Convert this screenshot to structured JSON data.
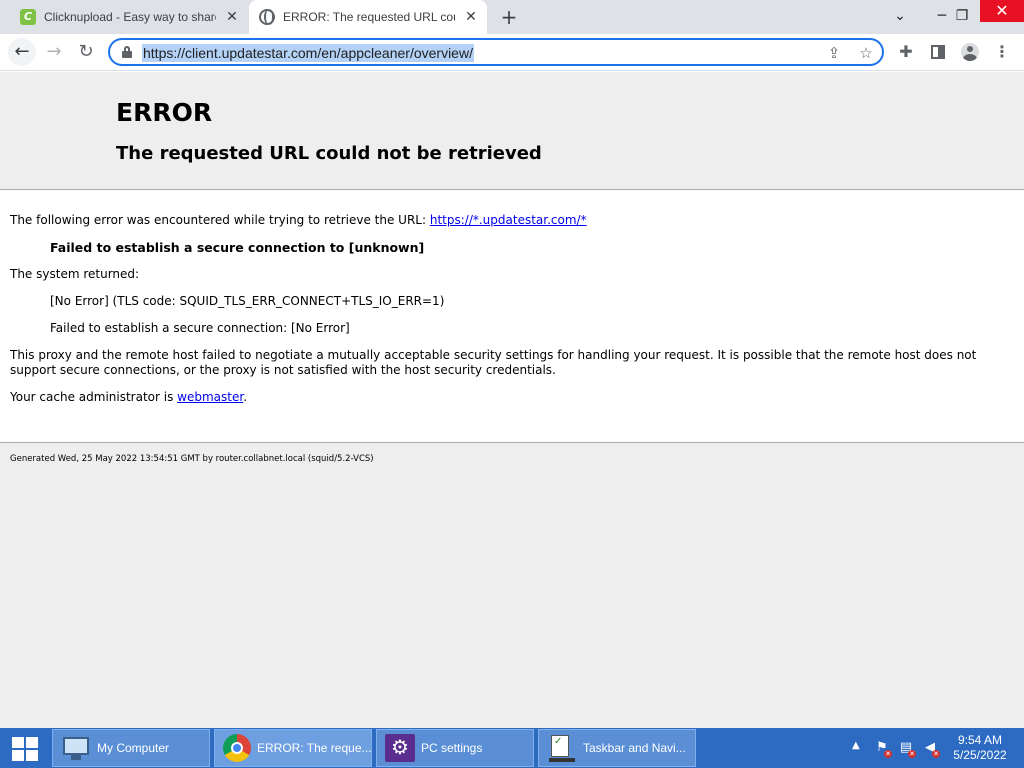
{
  "browser": {
    "tabs": [
      {
        "title": "Clicknupload - Easy way to share",
        "favicon": "clicknupload-icon",
        "active": false
      },
      {
        "title": "ERROR: The requested URL could not be retrieved",
        "favicon": "globe-icon",
        "active": true
      }
    ],
    "new_tab_label": "+",
    "address_bar": {
      "url": "https://client.updatestar.com/en/appcleaner/overview/"
    }
  },
  "page": {
    "heading": "ERROR",
    "subheading": "The requested URL could not be retrieved",
    "intro_text": "The following error was encountered while trying to retrieve the URL: ",
    "intro_link": "https://*.updatestar.com/*",
    "error_message": "Failed to establish a secure connection to [unknown]",
    "system_returned_label": "The system returned:",
    "tls_code": "[No Error] (TLS code: SQUID_TLS_ERR_CONNECT+TLS_IO_ERR=1)",
    "secure_fail": "Failed to establish a secure connection: [No Error]",
    "explanation": "This proxy and the remote host failed to negotiate a mutually acceptable security settings for handling your request. It is possible that the remote host does not support secure connections, or the proxy is not satisfied with the host security credentials.",
    "cache_admin_text": "Your cache administrator is ",
    "cache_admin_link": "webmaster",
    "cache_admin_suffix": ".",
    "footer": "Generated Wed, 25 May 2022 13:54:51 GMT by router.collabnet.local (squid/5.2-VCS)"
  },
  "taskbar": {
    "buttons": [
      {
        "label": "My Computer",
        "icon": "computer-icon"
      },
      {
        "label": "ERROR: The reque...",
        "icon": "chrome-icon"
      },
      {
        "label": "PC settings",
        "icon": "gear-icon"
      },
      {
        "label": "Taskbar and Navi...",
        "icon": "checklist-icon"
      }
    ],
    "clock": {
      "time": "9:54 AM",
      "date": "5/25/2022"
    }
  }
}
